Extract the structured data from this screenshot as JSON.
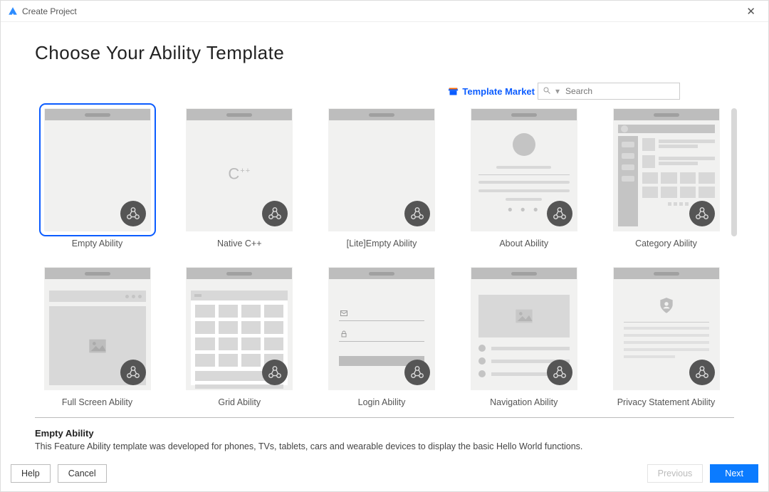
{
  "window": {
    "title": "Create Project"
  },
  "page": {
    "heading": "Choose Your Ability Template"
  },
  "market": {
    "label": "Template Market"
  },
  "search": {
    "placeholder": "Search"
  },
  "templates": [
    {
      "label": "Empty Ability",
      "kind": "empty",
      "selected": true
    },
    {
      "label": "Native C++",
      "kind": "cpp"
    },
    {
      "label": "[Lite]Empty Ability",
      "kind": "empty"
    },
    {
      "label": "About Ability",
      "kind": "about"
    },
    {
      "label": "Category Ability",
      "kind": "category"
    },
    {
      "label": "Full Screen Ability",
      "kind": "fullscreen"
    },
    {
      "label": "Grid Ability",
      "kind": "grid"
    },
    {
      "label": "Login Ability",
      "kind": "login"
    },
    {
      "label": "Navigation Ability",
      "kind": "navigation"
    },
    {
      "label": "Privacy Statement Ability",
      "kind": "privacy"
    }
  ],
  "description": {
    "title": "Empty Ability",
    "text": "This Feature Ability template was developed for phones, TVs, tablets, cars and wearable devices to display the basic Hello World functions."
  },
  "footer": {
    "help": "Help",
    "cancel": "Cancel",
    "previous": "Previous",
    "next": "Next"
  }
}
